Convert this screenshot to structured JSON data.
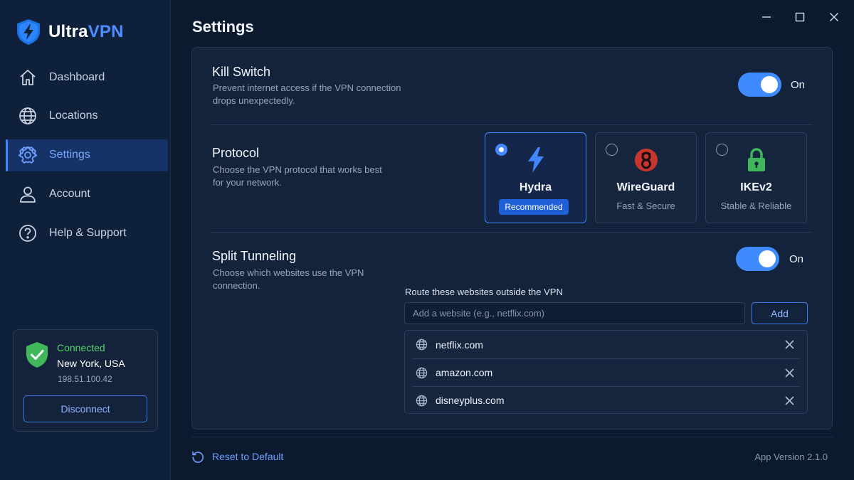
{
  "app": {
    "name_part1": "Ultra",
    "name_part2": "VPN",
    "accent_color": "#3f86ff",
    "connected_color": "#57d26b"
  },
  "window_controls": [
    "minimize-icon",
    "maximize-icon",
    "close-icon"
  ],
  "sidebar": {
    "items": [
      {
        "label": "Dashboard",
        "icon": "home-icon",
        "active": false
      },
      {
        "label": "Locations",
        "icon": "globe-icon",
        "active": false
      },
      {
        "label": "Settings",
        "icon": "gear-icon",
        "active": true
      },
      {
        "label": "Account",
        "icon": "user-icon",
        "active": false
      },
      {
        "label": "Help & Support",
        "icon": "help-icon",
        "active": false
      }
    ],
    "status": {
      "state": "Connected",
      "location": "New York, USA",
      "ip": "198.51.100.42",
      "disconnect_label": "Disconnect"
    }
  },
  "page": {
    "title": "Settings"
  },
  "kill_switch": {
    "title": "Kill Switch",
    "description": "Prevent internet access if the VPN connection drops unexpectedly.",
    "enabled": true,
    "state_label": "On"
  },
  "protocol": {
    "title": "Protocol",
    "description": "Choose the VPN protocol that works best for your network.",
    "options": [
      {
        "name": "Hydra",
        "badge": "Recommended",
        "icon": "lightning-icon",
        "selected": true
      },
      {
        "name": "WireGuard",
        "subtitle": "Fast & Secure",
        "icon": "wireguard-icon",
        "selected": false
      },
      {
        "name": "IKEv2",
        "subtitle": "Stable & Reliable",
        "icon": "lock-icon",
        "selected": false
      }
    ]
  },
  "split_tunneling": {
    "title": "Split Tunneling",
    "description": "Choose which websites use the VPN connection.",
    "enabled": true,
    "state_label": "On",
    "route_label": "Route these websites outside the VPN",
    "input_placeholder": "Add a website (e.g., netflix.com)",
    "input_value": "",
    "add_label": "Add",
    "sites": [
      "netflix.com",
      "amazon.com",
      "disneyplus.com"
    ]
  },
  "footer": {
    "reset_label": "Reset to Default",
    "version": "App Version 2.1.0"
  }
}
